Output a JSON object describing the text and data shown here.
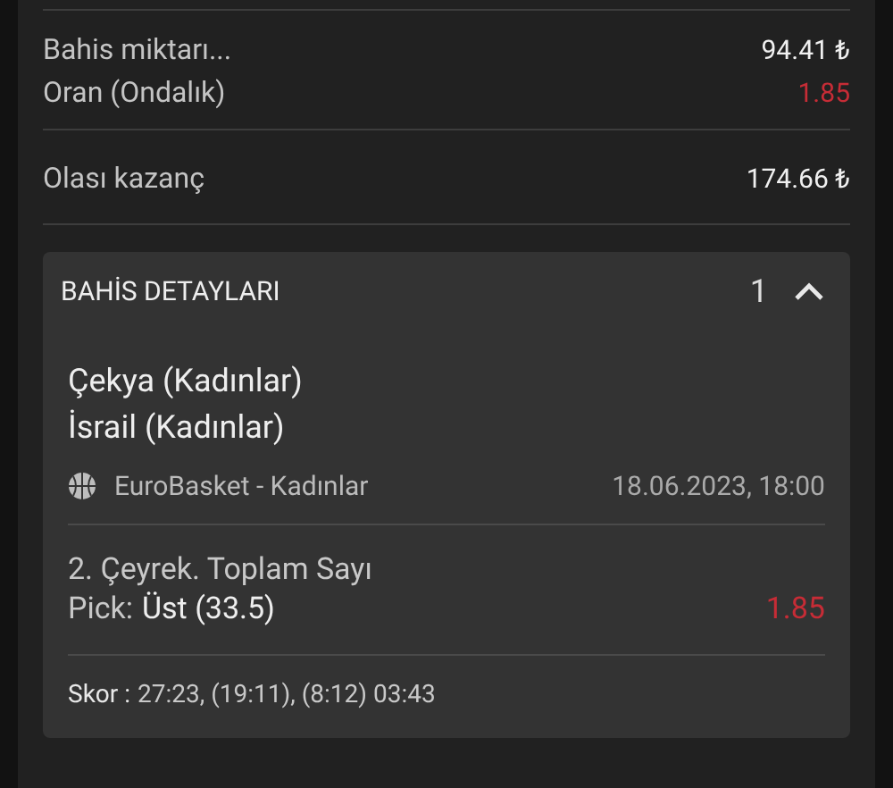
{
  "summary": [
    {
      "label": "Bahis miktarı...",
      "value": "94.41 ₺",
      "kind": "amount"
    },
    {
      "label": "Oran (Ondalık)",
      "value": "1.85",
      "kind": "odds"
    }
  ],
  "winnings": {
    "label": "Olası kazanç",
    "value": "174.66 ₺"
  },
  "details": {
    "title": "BAHİS DETAYLARI",
    "count": "1",
    "expanded": true,
    "teams": [
      "Çekya (Kadınlar)",
      "İsrail (Kadınlar)"
    ],
    "league": "EuroBasket - Kadınlar",
    "datetime": "18.06.2023, 18:00",
    "market": "2. Çeyrek. Toplam Sayı",
    "pick_label": "Pick:",
    "pick_value": "Üst (33.5)",
    "odds": "1.85",
    "score_label": "Skor :",
    "score_value": "27:23, (19:11), (8:12) 03:43"
  }
}
